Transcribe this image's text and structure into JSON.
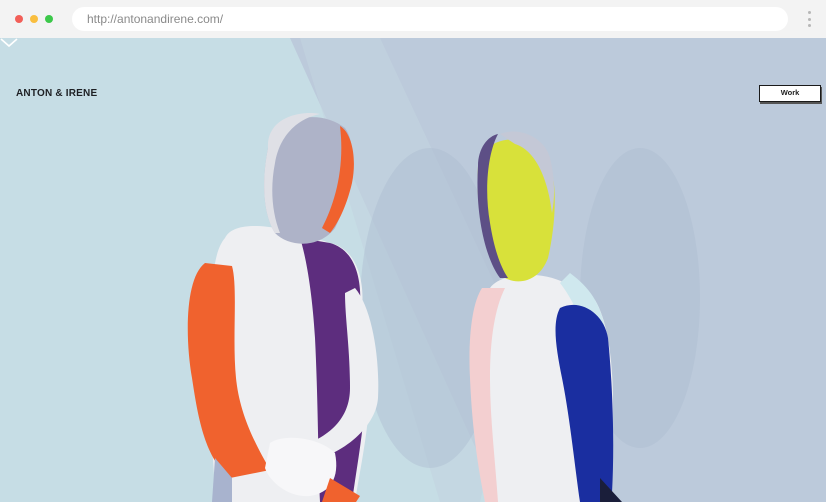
{
  "browser": {
    "url": "http://antonandirene.com/"
  },
  "site": {
    "brand": "ANTON & IRENE",
    "nav_button": "Work"
  },
  "icons": {
    "menu": "kebab-menu-icon",
    "scroll": "chevron-down-icon"
  },
  "colors": {
    "hero_left": "#c6dde5",
    "hero_right": "#bccadb",
    "suit_white": "#eeeff2",
    "orange": "#f0622e",
    "purple": "#5d2d7e",
    "yellow": "#d8e13a",
    "blue": "#1a2ea0",
    "pink": "#f3cfd0"
  }
}
